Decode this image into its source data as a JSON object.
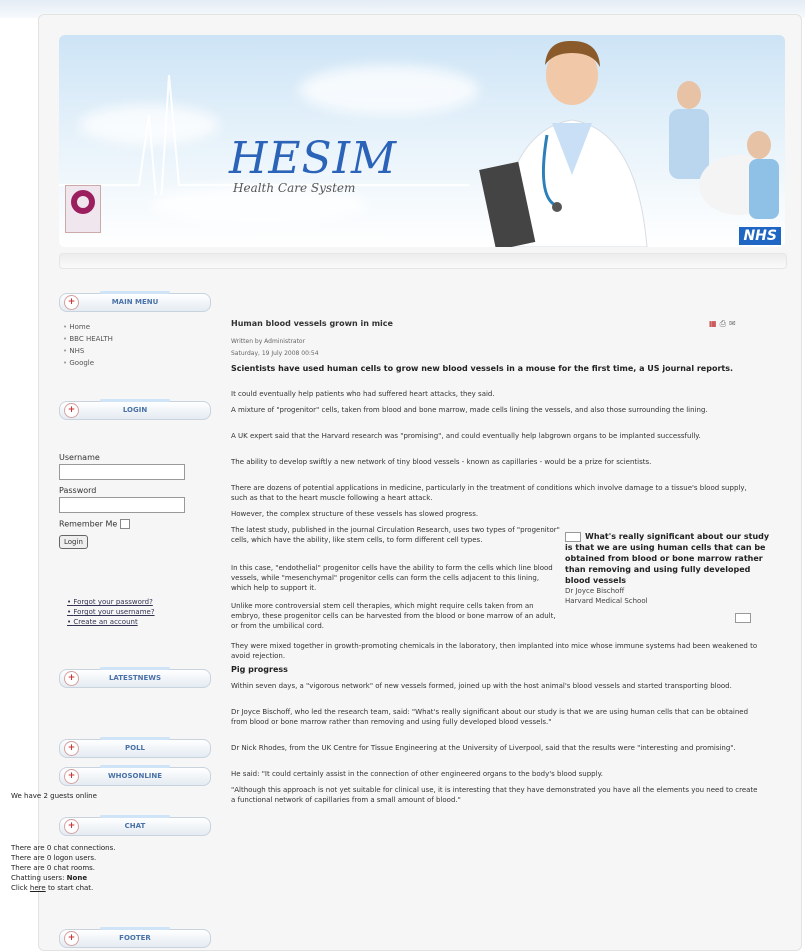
{
  "header": {
    "brand": "HESIM",
    "tagline": "Health Care System",
    "nhs_badge": "NHS"
  },
  "main_menu": {
    "title": "MAIN MENU",
    "items": [
      "Home",
      "BBC HEALTH",
      "NHS",
      "Google"
    ]
  },
  "login": {
    "title": "LOGIN",
    "username_label": "Username",
    "password_label": "Password",
    "remember_label": "Remember Me",
    "button": "Login",
    "links": [
      "Forgot your password?",
      "Forgot your username?",
      "Create an account"
    ]
  },
  "latestnews": {
    "title": "LATESTNEWS"
  },
  "poll": {
    "title": "POLL"
  },
  "whosonline": {
    "title": "WHOSONLINE",
    "text": "We have 2 guests online"
  },
  "chat": {
    "title": "CHAT",
    "lines": [
      "There are 0 chat connections.",
      "There are 0 logon users.",
      "There are 0 chat rooms."
    ],
    "users_label": "Chatting users:",
    "users_value": "None",
    "click_prefix": "Click",
    "click_link": "here",
    "click_suffix": "to start chat."
  },
  "footer": {
    "title": "FOOTER"
  },
  "article": {
    "title": "Human blood vessels grown in mice",
    "author": "Written by Administrator",
    "date": "Saturday, 19 July 2008 00:54",
    "lead": "Scientists have used human cells to grow new blood vessels in a mouse for the first time, a US journal reports.",
    "p1": "It could eventually help patients who had suffered heart attacks, they said.",
    "p2": "A mixture of \"progenitor\" cells, taken from blood and bone marrow, made cells lining the vessels, and also those surrounding the lining.",
    "p3": "A UK expert said that the Harvard research was \"promising\", and could eventually help labgrown organs to be implanted successfully.",
    "p4": "The ability to develop swiftly a new network of tiny blood vessels - known as capillaries - would be a prize for scientists.",
    "p5": "There are dozens of potential applications in medicine, particularly in the treatment of conditions which involve damage to a tissue's blood supply, such as that to the heart muscle following a heart attack.",
    "p6": "However, the complex structure of these vessels has slowed progress.",
    "p7": "The latest study, published in the journal Circulation Research, uses two types of \"progenitor\" cells, which have the ability, like stem cells, to form different cell types.",
    "p8": "In this case, \"endothelial\" progenitor cells have the ability to form the cells which line blood vessels, while \"mesenchymal\" progenitor cells can form the cells adjacent to this lining, which help to support it.",
    "p9": "Unlike more controversial stem cell therapies, which might require cells taken from an embryo, these progenitor cells can be harvested from the blood or bone marrow of an adult, or from the umbilical cord.",
    "p10": "They were mixed together in growth-promoting chemicals in the laboratory, then implanted into mice whose immune systems had been weakened to avoid rejection.",
    "subhead": "Pig progress",
    "p11": "Within seven days, a \"vigorous network\" of new vessels formed, joined up with the host animal's blood vessels and started transporting blood.",
    "p12": "Dr Joyce Bischoff, who led the research team, said: \"What's really significant about our study is that we are using human cells that can be obtained from blood or bone marrow rather than removing and using fully developed blood vessels.\"",
    "p13": "Dr Nick Rhodes, from the UK Centre for Tissue Engineering at the University of Liverpool, said that the results were \"interesting and promising\".",
    "p14": "He said: \"It could certainly assist in the connection of other engineered organs to the body's blood supply.",
    "p15": "\"Although this approach is not yet suitable for clinical use, it is interesting that they have demonstrated you have all the elements you need to create a functional network of capillaries from a small amount of blood.\"",
    "quote": "What's really significant about our study is that we are using human cells that can be obtained from blood or bone marrow rather than removing and using fully developed blood vessels",
    "quote_author": "Dr Joyce Bischoff",
    "quote_org": "Harvard Medical School"
  },
  "icons": [
    "pdf-icon",
    "print-icon",
    "email-icon"
  ]
}
